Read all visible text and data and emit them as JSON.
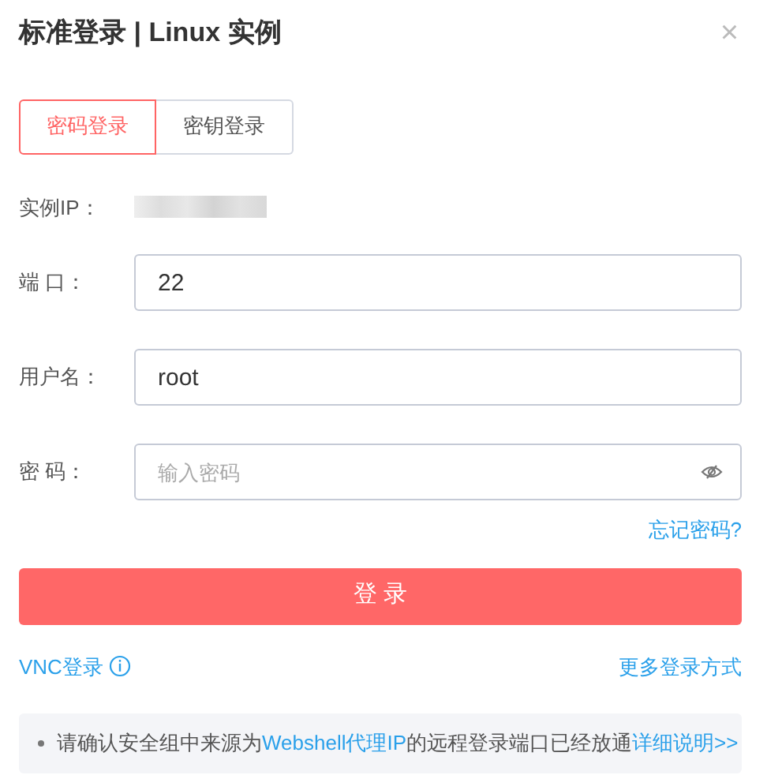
{
  "title": "标准登录 | Linux 实例",
  "close": "×",
  "tabs": [
    {
      "label": "密码登录",
      "selected": true
    },
    {
      "label": "密钥登录",
      "selected": false
    }
  ],
  "instance_ip": {
    "label": "实例IP："
  },
  "fields": [
    {
      "label": "端 口：",
      "value": "22"
    },
    {
      "label": "用户名：",
      "value": "root"
    },
    {
      "label": "密 码：",
      "placeholder": "输入密码",
      "kind": "password"
    }
  ],
  "forgot_link": "忘记密码?",
  "login_button": "登 录",
  "vnc_link": "VNC登录",
  "more_link": "更多登录方式",
  "note": [
    {
      "kind": "text",
      "text": "请确认安全组中来源为"
    },
    {
      "kind": "highlight",
      "text": "Webshell代理IP"
    },
    {
      "kind": "text",
      "text": "的远程登录端口已经放通"
    },
    {
      "kind": "link",
      "text": "详细说明>>"
    }
  ]
}
